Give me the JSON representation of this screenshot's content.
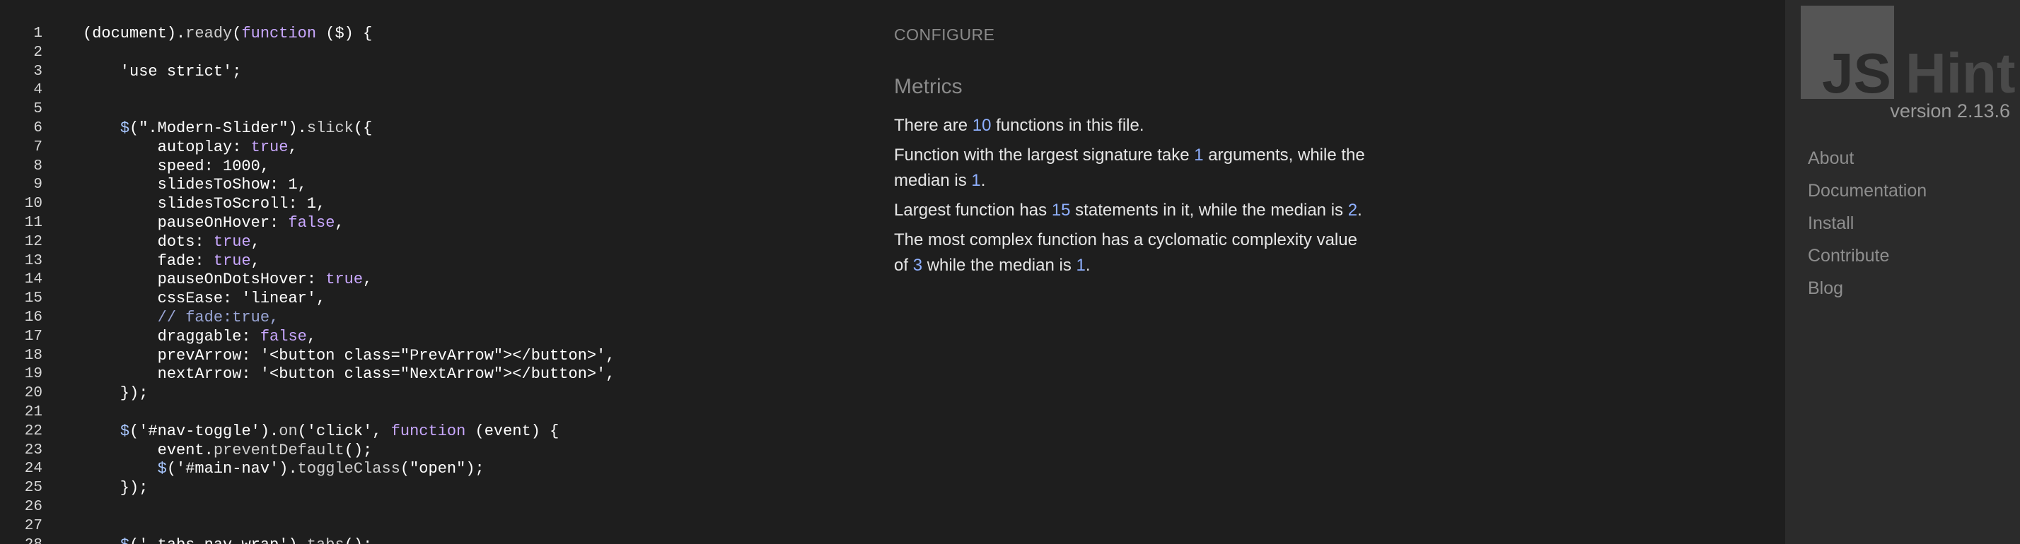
{
  "editor": {
    "lines": [
      {
        "n": "1",
        "t": "(document).ready(function ($) {"
      },
      {
        "n": "2",
        "t": ""
      },
      {
        "n": "3",
        "t": "    'use strict';"
      },
      {
        "n": "4",
        "t": ""
      },
      {
        "n": "5",
        "t": ""
      },
      {
        "n": "6",
        "t": "    $(\".Modern-Slider\").slick({"
      },
      {
        "n": "7",
        "t": "        autoplay: true,"
      },
      {
        "n": "8",
        "t": "        speed: 1000,"
      },
      {
        "n": "9",
        "t": "        slidesToShow: 1,"
      },
      {
        "n": "10",
        "t": "        slidesToScroll: 1,"
      },
      {
        "n": "11",
        "t": "        pauseOnHover: false,"
      },
      {
        "n": "12",
        "t": "        dots: true,"
      },
      {
        "n": "13",
        "t": "        fade: true,"
      },
      {
        "n": "14",
        "t": "        pauseOnDotsHover: true,"
      },
      {
        "n": "15",
        "t": "        cssEase: 'linear',"
      },
      {
        "n": "16",
        "t": "        // fade:true,"
      },
      {
        "n": "17",
        "t": "        draggable: false,"
      },
      {
        "n": "18",
        "t": "        prevArrow: '<button class=\"PrevArrow\"></button>',"
      },
      {
        "n": "19",
        "t": "        nextArrow: '<button class=\"NextArrow\"></button>',"
      },
      {
        "n": "20",
        "t": "    });"
      },
      {
        "n": "21",
        "t": ""
      },
      {
        "n": "22",
        "t": "    $('#nav-toggle').on('click', function (event) {"
      },
      {
        "n": "23",
        "t": "        event.preventDefault();"
      },
      {
        "n": "24",
        "t": "        $('#main-nav').toggleClass(\"open\");"
      },
      {
        "n": "25",
        "t": "    });"
      },
      {
        "n": "26",
        "t": ""
      },
      {
        "n": "27",
        "t": ""
      },
      {
        "n": "28",
        "t": "    $('.tabs_nav_wrap').tabs();"
      }
    ]
  },
  "report": {
    "configure_label": "CONFIGURE",
    "metrics_title": "Metrics",
    "metrics": {
      "functions_count": "10",
      "largest_signature_args": "1",
      "signature_median": "1",
      "largest_statements": "15",
      "statements_median": "2",
      "max_complexity": "3",
      "complexity_median": "1"
    },
    "text": {
      "m1_a": "There are ",
      "m1_b": " functions in this file.",
      "m2_a": "Function with the largest signature take ",
      "m2_b": " arguments, while the",
      "m2_c": "median is ",
      "m2_d": ".",
      "m3_a": "Largest function has ",
      "m3_b": " statements in it, while the median is ",
      "m3_c": ".",
      "m4_a": "The most complex function has a cyclomatic complexity value",
      "m4_b": "of ",
      "m4_c": " while the median is ",
      "m4_d": "."
    }
  },
  "sidebar": {
    "logo_js": "JS",
    "logo_hint": "Hint",
    "version": "version 2.13.6",
    "nav": [
      {
        "label": "About"
      },
      {
        "label": "Documentation"
      },
      {
        "label": "Install"
      },
      {
        "label": "Contribute"
      },
      {
        "label": "Blog"
      }
    ]
  },
  "colors": {
    "background": "#1e1e1e",
    "sidebar_bg": "#2b2b2b",
    "number_accent": "#8fb0ff",
    "keyword": "#c9a8ff",
    "comment": "#9aa6d6"
  }
}
